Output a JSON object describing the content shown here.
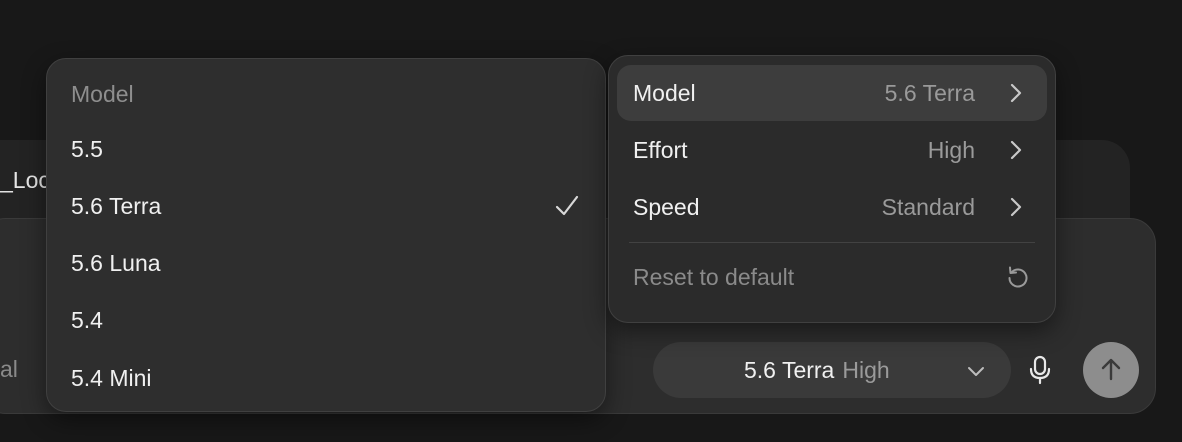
{
  "background": {
    "context_text": "_Loca",
    "composer_left_text": "al"
  },
  "composer": {
    "selected_model": "5.6 Terra",
    "selected_effort": "High"
  },
  "model_menu": {
    "title": "Model",
    "items": [
      {
        "label": "5.5",
        "selected": false
      },
      {
        "label": "5.6 Terra",
        "selected": true
      },
      {
        "label": "5.6 Luna",
        "selected": false
      },
      {
        "label": "5.4",
        "selected": false
      },
      {
        "label": "5.4 Mini",
        "selected": false
      }
    ]
  },
  "settings_menu": {
    "items": [
      {
        "label": "Model",
        "value": "5.6 Terra"
      },
      {
        "label": "Effort",
        "value": "High"
      },
      {
        "label": "Speed",
        "value": "Standard"
      }
    ],
    "reset_label": "Reset to default"
  },
  "icons": {
    "check": "check-icon",
    "chevron_right": "chevron-right-icon",
    "chevron_down": "chevron-down-icon",
    "reset": "reset-icon",
    "microphone": "microphone-icon",
    "send": "arrow-up-icon"
  },
  "colors": {
    "page_background": "#181818",
    "menu_background": "#2e2e2e",
    "highlight": "#3d3d3d",
    "send_button": "#8d8d8d"
  }
}
